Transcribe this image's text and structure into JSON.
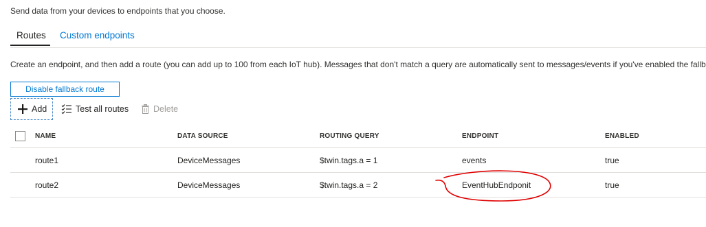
{
  "intro_text": "Send data from your devices to endpoints that you choose.",
  "tabs": [
    {
      "label": "Routes",
      "active": true
    },
    {
      "label": "Custom endpoints",
      "active": false
    }
  ],
  "description": "Create an endpoint, and then add a route (you can add up to 100 from each IoT hub). Messages that don't match a query are automatically sent to messages/events if you've enabled the fallba",
  "fallback_button_label": "Disable fallback route",
  "toolbar": {
    "add_label": "Add",
    "test_label": "Test all routes",
    "delete_label": "Delete"
  },
  "table": {
    "columns": [
      "NAME",
      "DATA SOURCE",
      "ROUTING QUERY",
      "ENDPOINT",
      "ENABLED"
    ],
    "rows": [
      {
        "name": "route1",
        "source": "DeviceMessages",
        "query": "$twin.tags.a = 1",
        "endpoint": "events",
        "enabled": "true"
      },
      {
        "name": "route2",
        "source": "DeviceMessages",
        "query": "$twin.tags.a = 2",
        "endpoint": "EventHubEndponit",
        "enabled": "true"
      }
    ]
  },
  "colors": {
    "accent": "#0078d4",
    "annotation": "#e00000",
    "disabled_text": "#a19f9d",
    "divider": "#e1dfdd"
  },
  "icons": [
    "plus-icon",
    "checklist-icon",
    "trash-icon"
  ]
}
